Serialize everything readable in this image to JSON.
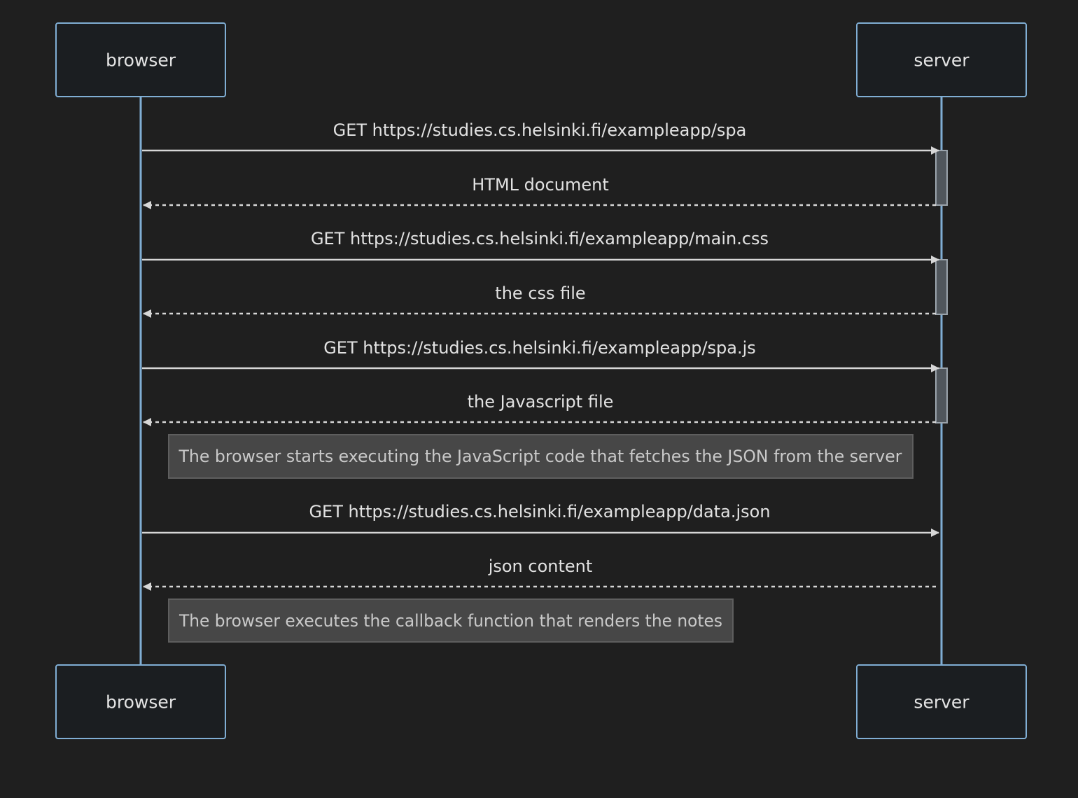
{
  "participants": {
    "browser": "browser",
    "server": "server"
  },
  "messages": [
    {
      "text": "GET https://studies.cs.helsinki.fi/exampleapp/spa",
      "from": "browser",
      "to": "server",
      "style": "solid"
    },
    {
      "text": "HTML document",
      "from": "server",
      "to": "browser",
      "style": "dashed"
    },
    {
      "text": "GET https://studies.cs.helsinki.fi/exampleapp/main.css",
      "from": "browser",
      "to": "server",
      "style": "solid"
    },
    {
      "text": "the css file",
      "from": "server",
      "to": "browser",
      "style": "dashed"
    },
    {
      "text": "GET https://studies.cs.helsinki.fi/exampleapp/spa.js",
      "from": "browser",
      "to": "server",
      "style": "solid"
    },
    {
      "text": "the Javascript file",
      "from": "server",
      "to": "browser",
      "style": "dashed"
    },
    {
      "text": "GET https://studies.cs.helsinki.fi/exampleapp/data.json",
      "from": "browser",
      "to": "server",
      "style": "solid"
    },
    {
      "text": "json content",
      "from": "server",
      "to": "browser",
      "style": "dashed"
    }
  ],
  "notes": [
    {
      "text": "The browser starts executing the JavaScript code that fetches the JSON from the server"
    },
    {
      "text": "The browser executes the callback function that renders the notes"
    }
  ],
  "colors": {
    "background": "#1f1f1f",
    "actor_border": "#80aed4",
    "actor_fill": "#1b1e21",
    "message_line": "#d7d7d7",
    "note_fill": "#474747",
    "activation_fill": "#50565c"
  }
}
